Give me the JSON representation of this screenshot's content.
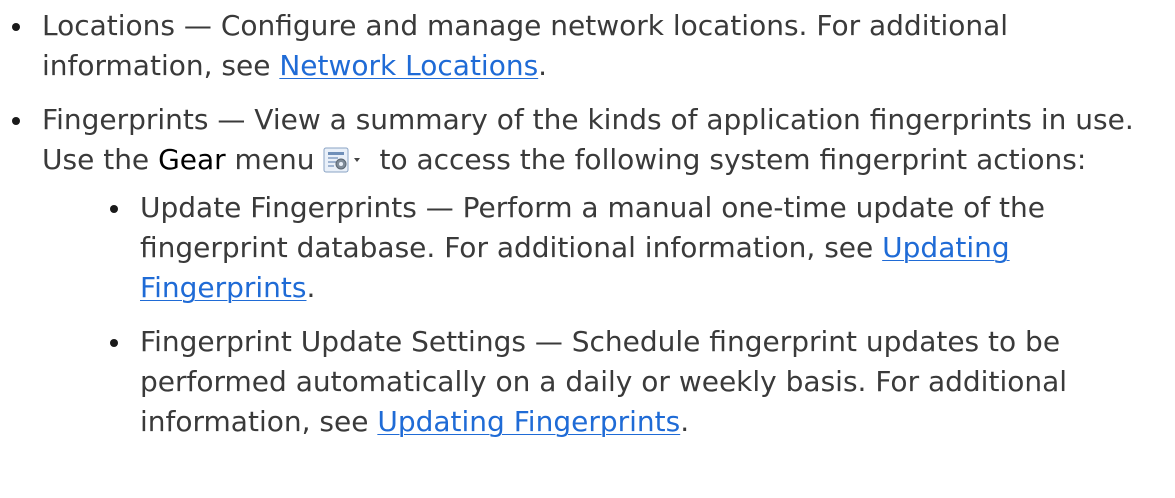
{
  "bullets": {
    "locations": {
      "lead": "Locations — Configure and manage network locations. For additional information, see ",
      "link": "Network Locations",
      "tail": "."
    },
    "fingerprints": {
      "lead": "Fingerprints — View a summary of the kinds of application fingerprints in use. Use the ",
      "ui_label": "Gear",
      "mid": " menu",
      "tail": " to access the following system fingerprint actions:",
      "icon": "gear-menu-icon"
    },
    "update_fingerprints": {
      "lead": "Update Fingerprints — Perform a manual one-time update of the fingerprint database. For additional information, see ",
      "link": "Updating Fingerprints",
      "tail": "."
    },
    "fingerprint_update_settings": {
      "lead": "Fingerprint Update Settings — Schedule fingerprint updates to be performed automatically on a daily or weekly basis. For additional information, see ",
      "link": "Updating Fingerprints",
      "tail": "."
    }
  },
  "colors": {
    "text": "#3a3a3a",
    "link": "#1f6bd6",
    "ui_label": "#000000"
  }
}
